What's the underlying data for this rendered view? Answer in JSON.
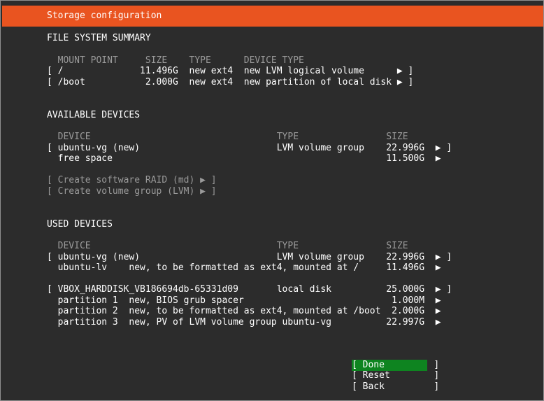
{
  "colors": {
    "accent": "#e95420",
    "selected": "#0e8420",
    "background": "#2c2c2c",
    "dim": "#9a9a9a"
  },
  "title": "Storage configuration",
  "fs_summary": {
    "heading": "FILE SYSTEM SUMMARY",
    "header": "  MOUNT POINT     SIZE    TYPE      DEVICE TYPE",
    "rows": [
      "[ /              11.496G  new ext4  new LVM logical volume      ▶ ]",
      "[ /boot           2.000G  new ext4  new partition of local disk ▶ ]"
    ]
  },
  "available": {
    "heading": "AVAILABLE DEVICES",
    "header": "  DEVICE                                  TYPE                SIZE",
    "rows": [
      "[ ubuntu-vg (new)                         LVM volume group    22.996G  ▶ ]",
      "  free space                                                  11.500G  ▶"
    ],
    "actions": [
      "[ Create software RAID (md) ▶ ]",
      "[ Create volume group (LVM) ▶ ]"
    ]
  },
  "used": {
    "heading": "USED DEVICES",
    "header": "  DEVICE                                  TYPE                SIZE",
    "rows": [
      "[ ubuntu-vg (new)                         LVM volume group    22.996G  ▶ ]",
      "  ubuntu-lv    new, to be formatted as ext4, mounted at /     11.496G  ▶",
      "[ VBOX_HARDDISK_VB186694db-65331d09       local disk          25.000G  ▶ ]",
      "  partition 1  new, BIOS grub spacer                           1.000M  ▶",
      "  partition 2  new, to be formatted as ext4, mounted at /boot  2.000G  ▶",
      "  partition 3  new, PV of LVM volume group ubuntu-vg          22.997G  ▶"
    ]
  },
  "buttons": {
    "done": "[ Done         ]",
    "reset": "[ Reset        ]",
    "back": "[ Back         ]"
  }
}
